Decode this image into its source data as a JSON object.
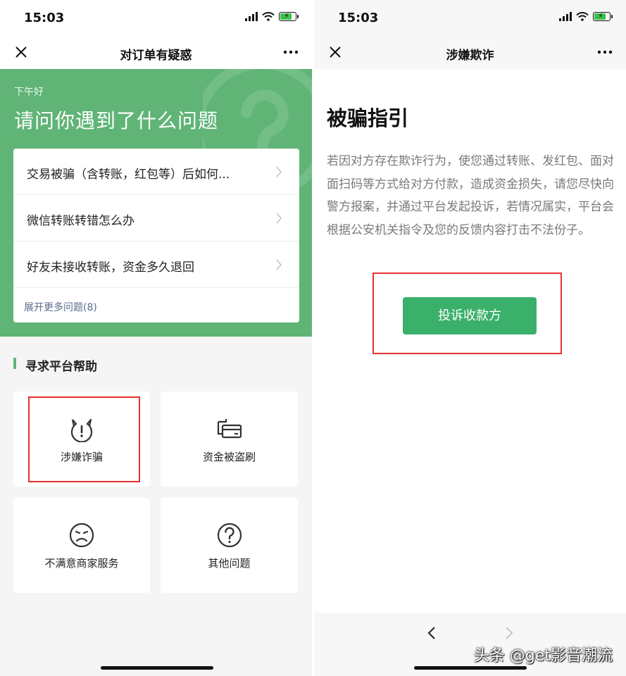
{
  "left": {
    "status": {
      "time": "15:03"
    },
    "nav": {
      "title": "对订单有疑惑"
    },
    "hero": {
      "greeting": "下午好",
      "headline": "请问你遇到了什么问题"
    },
    "faq": {
      "items": [
        {
          "label": "交易被骗（含转账，红包等）后如何..."
        },
        {
          "label": "微信转账转错怎么办"
        },
        {
          "label": "好友未接收转账，资金多久退回"
        }
      ],
      "more_label": "展开更多问题(8)"
    },
    "section": {
      "title": "寻求平台帮助"
    },
    "tiles": [
      {
        "label": "涉嫌诈骗",
        "icon": "devil-alert-icon"
      },
      {
        "label": "资金被盗刷",
        "icon": "card-swipe-icon"
      },
      {
        "label": "不满意商家服务",
        "icon": "sad-face-icon"
      },
      {
        "label": "其他问题",
        "icon": "question-circle-icon"
      }
    ]
  },
  "right": {
    "status": {
      "time": "15:03"
    },
    "nav": {
      "title": "涉嫌欺诈"
    },
    "guide": {
      "title": "被骗指引",
      "body": "若因对方存在欺诈行为，使您通过转账、发红包、面对面扫码等方式给对方付款，造成资金损失，请您尽快向警方报案，并通过平台发起投诉，若情况属实，平台会根据公安机关指令及您的反馈内容打击不法份子。"
    },
    "button": {
      "label": "投诉收款方"
    }
  },
  "watermark": "头条 @get影音潮流",
  "colors": {
    "brand_green": "#5fb476",
    "button_green": "#3ab06a",
    "highlight_red": "#e53030",
    "link_blue": "#5b6b8c"
  }
}
